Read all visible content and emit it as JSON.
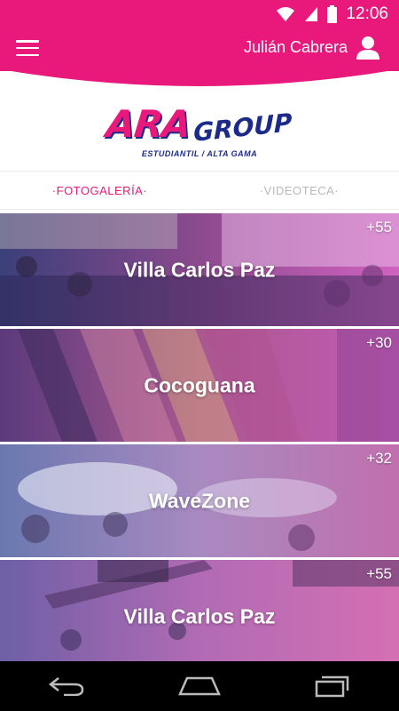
{
  "status_bar": {
    "time": "12:06"
  },
  "header": {
    "user_name": "Julián Cabrera"
  },
  "logo": {
    "main": "ARA",
    "secondary": "GROUP",
    "tagline": "ESTUDIANTIL / ALTA GAMA"
  },
  "tabs": [
    {
      "label": "·FOTOGALERÍA·",
      "active": true
    },
    {
      "label": "·VIDEOTECA·",
      "active": false
    }
  ],
  "gallery": [
    {
      "title": "Villa Carlos Paz",
      "count": "+55"
    },
    {
      "title": "Cocoguana",
      "count": "+30"
    },
    {
      "title": "WaveZone",
      "count": "+32"
    },
    {
      "title": "Villa Carlos Paz",
      "count": "+55"
    }
  ],
  "colors": {
    "brand_pink": "#e8197a",
    "brand_blue": "#1c2a8a"
  }
}
